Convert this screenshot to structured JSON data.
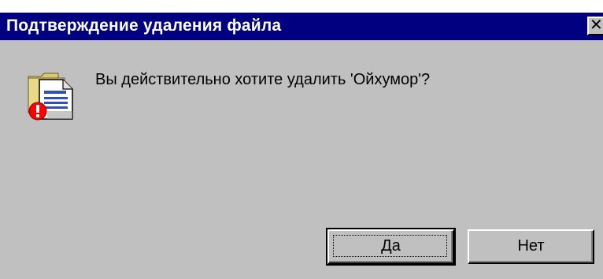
{
  "window": {
    "title": "Подтверждение удаления файла",
    "close_glyph": "✕"
  },
  "message": {
    "icon": "delete-file-warning-icon",
    "text": "Вы действительно хотите удалить 'Ойхумор'?"
  },
  "buttons": {
    "yes_label": "Да",
    "no_label": "Нет"
  },
  "colors": {
    "titlebar": "#000080",
    "face": "#c0c0c0",
    "title_text": "#ffffff"
  }
}
